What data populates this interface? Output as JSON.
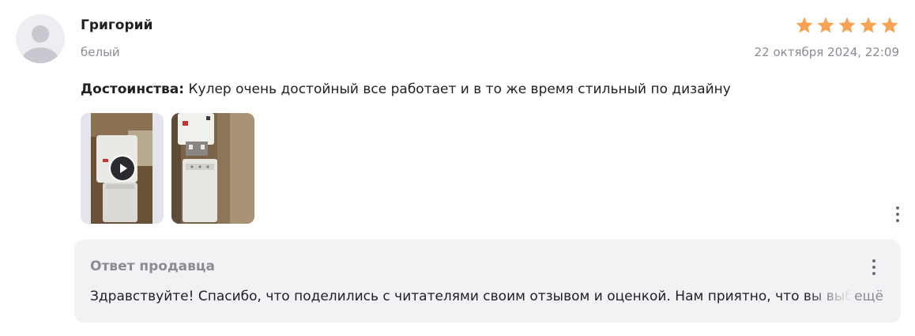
{
  "review": {
    "author": "Григорий",
    "variant": "белый",
    "rating": 5,
    "rating_max": 5,
    "date": "22 октября 2024, 22:09",
    "pros_label": "Достоинства:",
    "pros_text": " Кулер очень достойный все работает и в то же время стильный по дизайну",
    "media": [
      {
        "type": "video",
        "icon": "play-icon"
      },
      {
        "type": "photo"
      }
    ],
    "more_icon": "more-vertical-icon"
  },
  "seller_reply": {
    "title": "Ответ продавца",
    "text": "Здравствуйте! Спасибо, что поделились с читателями своим отзывом и оценкой. Нам приятно, что вы выбрали нашу продукцию",
    "expand_label": "ещё",
    "more_icon": "more-vertical-icon"
  },
  "colors": {
    "star": "#f9a251",
    "muted_text": "#8b8b96",
    "reply_background": "#f2f2f5"
  }
}
